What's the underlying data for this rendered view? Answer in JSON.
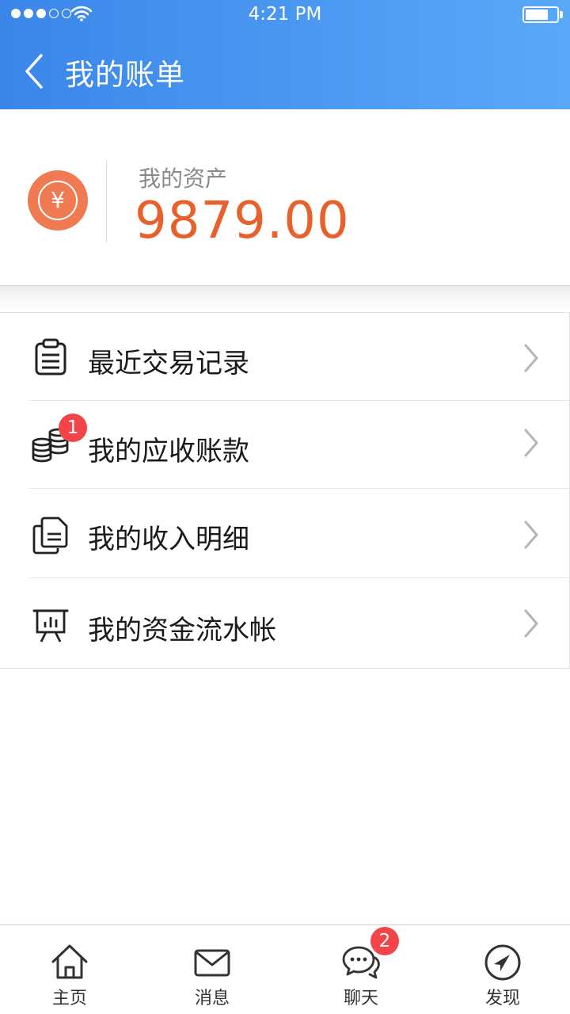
{
  "status_bar": {
    "time": "4:21 PM"
  },
  "header": {
    "title": "我的账单"
  },
  "assets": {
    "label": "我的资产",
    "amount": "9879.00",
    "currency_symbol": "¥"
  },
  "menu": {
    "items": [
      {
        "label": "最近交易记录",
        "icon": "clipboard-icon"
      },
      {
        "label": "我的应收账款",
        "icon": "coins-icon",
        "badge": "1"
      },
      {
        "label": "我的收入明细",
        "icon": "documents-icon"
      },
      {
        "label": "我的资金流水帐",
        "icon": "presentation-chart-icon"
      }
    ]
  },
  "tabbar": {
    "tabs": [
      {
        "label": "主页",
        "icon": "home-icon"
      },
      {
        "label": "消息",
        "icon": "mail-icon"
      },
      {
        "label": "聊天",
        "icon": "chat-icon",
        "badge": "2"
      },
      {
        "label": "发现",
        "icon": "compass-icon"
      }
    ]
  },
  "colors": {
    "header_start": "#3a86ea",
    "header_end": "#5aa8f8",
    "accent": "#e8602c",
    "coin": "#f07b52",
    "badge": "#f24449"
  }
}
